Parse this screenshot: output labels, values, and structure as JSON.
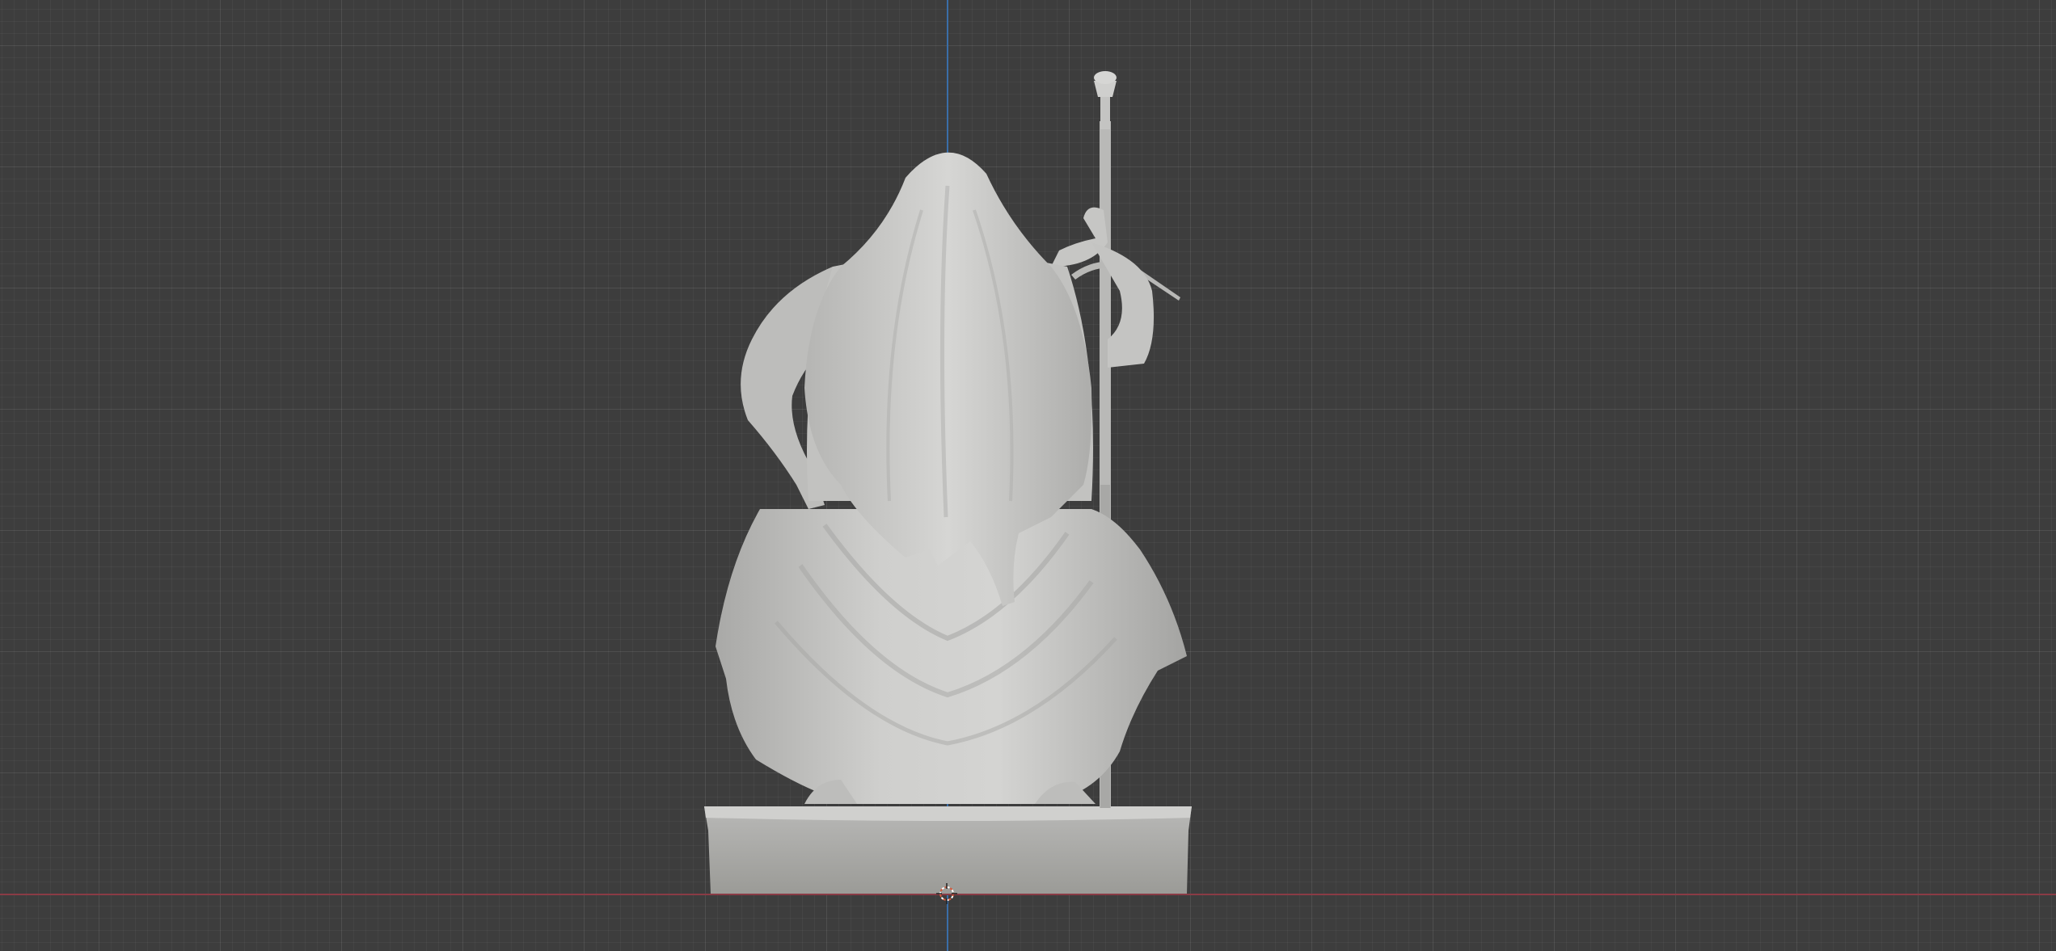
{
  "viewport": {
    "background_color": "#3d3d3d",
    "grid_color": "#4a4a4a",
    "x_axis_color": "#8a3b45",
    "y_axis_color": "#3a6ea8"
  },
  "scene": {
    "object": "statue-hooded-figure-with-sword",
    "material_color": "#c9c9c7"
  },
  "cursor": {
    "icon": "3d-cursor-icon"
  }
}
